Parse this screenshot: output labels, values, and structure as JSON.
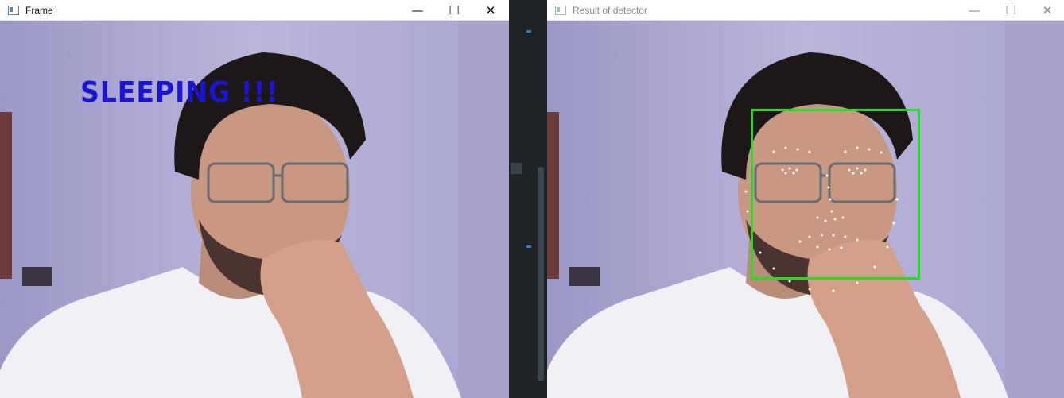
{
  "windows": {
    "frame": {
      "title": "Frame",
      "overlay_text": "SLEEPING !!!"
    },
    "detector": {
      "title": "Result of detector"
    }
  },
  "title_controls": {
    "minimize": "—",
    "maximize": "☐",
    "close": "✕"
  },
  "colors": {
    "alert_text": "#1a14d6",
    "face_box": "#1fe01f",
    "landmark": "#ffffff"
  }
}
